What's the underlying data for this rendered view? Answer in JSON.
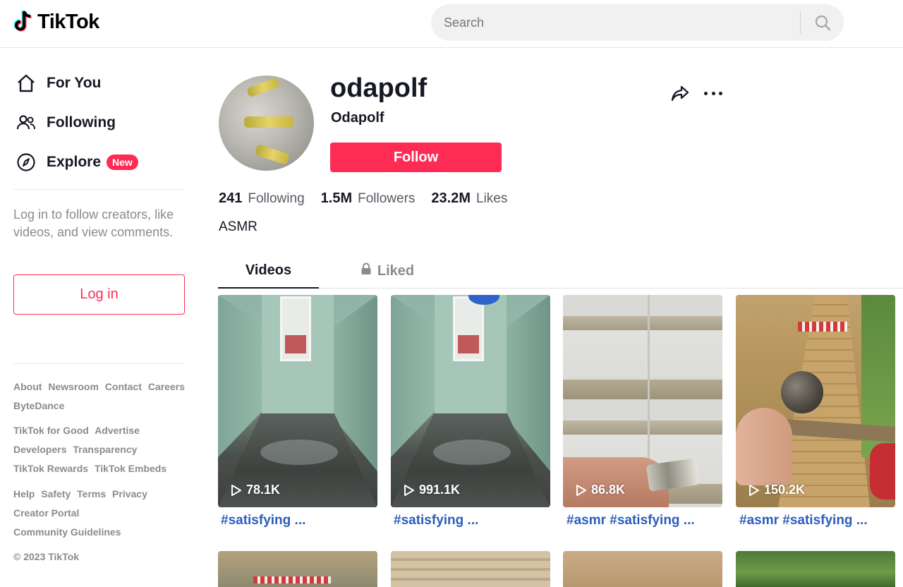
{
  "brand": {
    "name": "TikTok"
  },
  "search": {
    "placeholder": "Search"
  },
  "sidebar": {
    "nav": [
      {
        "label": "For You",
        "icon": "home-icon"
      },
      {
        "label": "Following",
        "icon": "people-icon"
      },
      {
        "label": "Explore",
        "icon": "compass-icon",
        "badge": "New"
      }
    ],
    "login_prompt": "Log in to follow creators, like videos, and view comments.",
    "login_button": "Log in",
    "footer": {
      "group1": [
        "About",
        "Newsroom",
        "Contact",
        "Careers",
        "ByteDance"
      ],
      "group2": [
        "TikTok for Good",
        "Advertise",
        "Developers",
        "Transparency",
        "TikTok Rewards",
        "TikTok Embeds"
      ],
      "group3": [
        "Help",
        "Safety",
        "Terms",
        "Privacy",
        "Creator Portal",
        "Community Guidelines"
      ],
      "copyright": "© 2023 TikTok"
    }
  },
  "profile": {
    "username": "odapolf",
    "nickname": "Odapolf",
    "follow_button": "Follow",
    "stats": {
      "following": {
        "value": "241",
        "label": "Following"
      },
      "followers": {
        "value": "1.5M",
        "label": "Followers"
      },
      "likes": {
        "value": "23.2M",
        "label": "Likes"
      }
    },
    "bio": "ASMR"
  },
  "tabs": [
    {
      "label": "Videos",
      "active": true
    },
    {
      "label": "Liked",
      "active": false,
      "locked": true
    }
  ],
  "videos": [
    {
      "views": "78.1K",
      "caption": "#satisfying ..."
    },
    {
      "views": "991.1K",
      "caption": "#satisfying ..."
    },
    {
      "views": "86.8K",
      "caption": "#asmr #satisfying ..."
    },
    {
      "views": "150.2K",
      "caption": "#asmr #satisfying ..."
    }
  ],
  "colors": {
    "accent": "#fe2c55",
    "caption_link": "#2b5db9",
    "text_primary": "#161823",
    "text_muted": "#8a8b91"
  }
}
